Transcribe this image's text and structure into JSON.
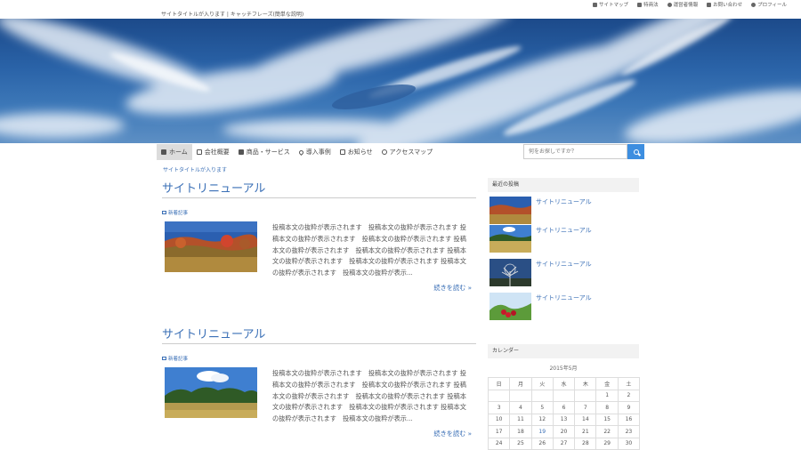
{
  "header": {
    "tagline": "サイトタイトルが入ります | キャッチフレーズ(簡単な説明)",
    "util_nav": [
      {
        "label": "サイトマップ",
        "icon": "sitemap-icon"
      },
      {
        "label": "特商法",
        "icon": "wrench-icon"
      },
      {
        "label": "運営者情報",
        "icon": "info-icon"
      },
      {
        "label": "お問い合わせ",
        "icon": "mail-icon"
      },
      {
        "label": "プロフィール",
        "icon": "user-icon"
      }
    ]
  },
  "nav": {
    "items": [
      {
        "label": "ホーム",
        "icon": "home-icon"
      },
      {
        "label": "会社概要",
        "icon": "building-icon"
      },
      {
        "label": "商品・サービス",
        "icon": "cubes-icon"
      },
      {
        "label": "導入事例",
        "icon": "pin-icon"
      },
      {
        "label": "お知らせ",
        "icon": "newspaper-icon"
      },
      {
        "label": "アクセスマップ",
        "icon": "compass-icon"
      }
    ],
    "active_index": 0
  },
  "search": {
    "placeholder": "何をお探しですか？"
  },
  "breadcrumb": {
    "text": "サイトタイトルが入ります"
  },
  "articles": [
    {
      "title": "サイトリニューアル",
      "category": "新着記事",
      "excerpt": "投稿本文の抜粋が表示されます　投稿本文の抜粋が表示されます 投稿本文の抜粋が表示されます　投稿本文の抜粋が表示されます 投稿本文の抜粋が表示されます　投稿本文の抜粋が表示されます 投稿本文の抜粋が表示されます　投稿本文の抜粋が表示されます 投稿本文の抜粋が表示されます　投稿本文の抜粋が表示...",
      "read_more": "続きを読む »"
    },
    {
      "title": "サイトリニューアル",
      "category": "新着記事",
      "excerpt": "投稿本文の抜粋が表示されます　投稿本文の抜粋が表示されます 投稿本文の抜粋が表示されます　投稿本文の抜粋が表示されます 投稿本文の抜粋が表示されます　投稿本文の抜粋が表示されます 投稿本文の抜粋が表示されます　投稿本文の抜粋が表示されます 投稿本文の抜粋が表示されます　投稿本文の抜粋が表示...",
      "read_more": "続きを読む »"
    }
  ],
  "sidebar": {
    "recent_heading": "最近の投稿",
    "recent_posts": [
      {
        "title": "サイトリニューアル"
      },
      {
        "title": "サイトリニューアル"
      },
      {
        "title": "サイトリニューアル"
      },
      {
        "title": "サイトリニューアル"
      }
    ],
    "calendar_heading": "カレンダー",
    "calendar": {
      "caption": "2015年5月",
      "weekdays": [
        "日",
        "月",
        "火",
        "水",
        "木",
        "金",
        "土"
      ],
      "weeks": [
        [
          "",
          "",
          "",
          "",
          "",
          "1",
          "2"
        ],
        [
          "3",
          "4",
          "5",
          "6",
          "7",
          "8",
          "9"
        ],
        [
          "10",
          "11",
          "12",
          "13",
          "14",
          "15",
          "16"
        ],
        [
          "17",
          "18",
          "19",
          "20",
          "21",
          "22",
          "23"
        ],
        [
          "24",
          "25",
          "26",
          "27",
          "28",
          "29",
          "30"
        ]
      ],
      "linked_day": "19"
    }
  },
  "colors": {
    "link": "#3a6fb6",
    "accent": "#3d8ee0",
    "nav_active": "#dcdcdc"
  }
}
